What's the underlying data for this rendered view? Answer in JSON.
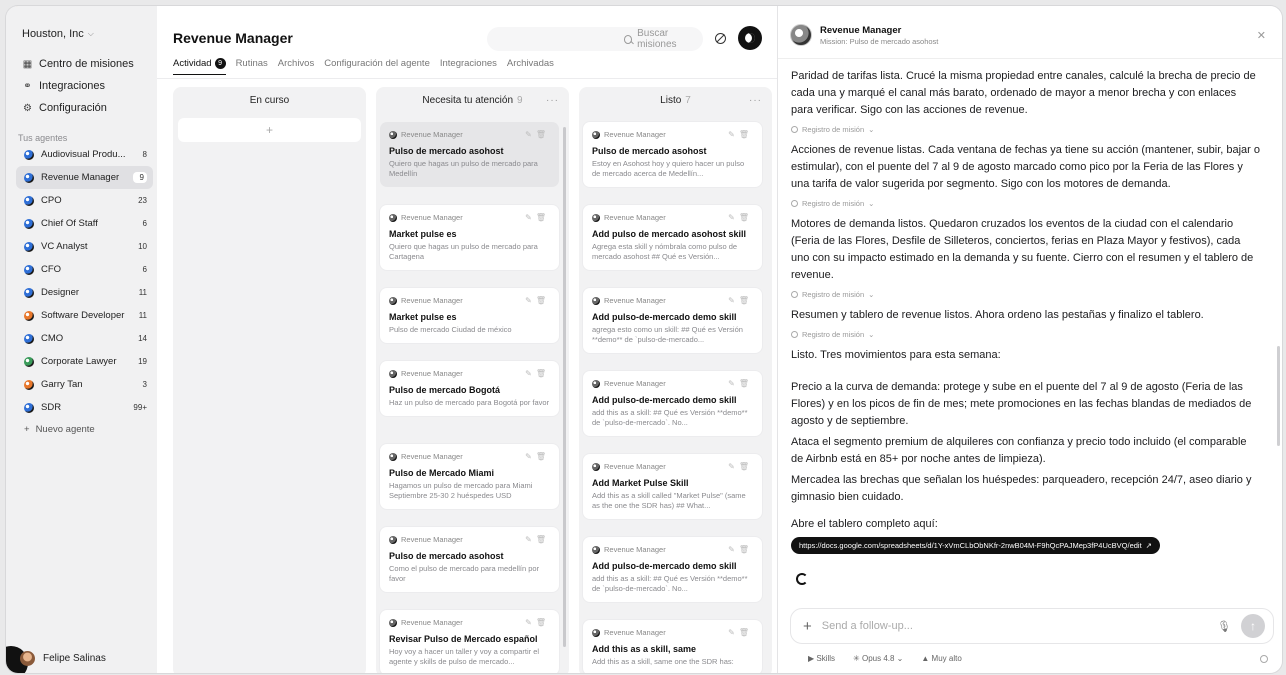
{
  "sidebar": {
    "workspace": "Houston, Inc",
    "nav": [
      {
        "label": "Centro de misiones",
        "icon": "grid-icon"
      },
      {
        "label": "Integraciones",
        "icon": "link-icon"
      },
      {
        "label": "Configuración",
        "icon": "gear-icon"
      }
    ],
    "agents_label": "Tus agentes",
    "agents": [
      {
        "name": "Audiovisual Produ...",
        "count": "8"
      },
      {
        "name": "Revenue Manager",
        "count": "9"
      },
      {
        "name": "CPO",
        "count": "23"
      },
      {
        "name": "Chief Of Staff",
        "count": "6"
      },
      {
        "name": "VC Analyst",
        "count": "10"
      },
      {
        "name": "CFO",
        "count": "6"
      },
      {
        "name": "Designer",
        "count": "11"
      },
      {
        "name": "Software Developer",
        "count": "11"
      },
      {
        "name": "CMO",
        "count": "14"
      },
      {
        "name": "Corporate Lawyer",
        "count": "19"
      },
      {
        "name": "Garry Tan",
        "count": "3"
      },
      {
        "name": "SDR",
        "count": "99+"
      }
    ],
    "new_agent": "Nuevo agente",
    "user": "Felipe Salinas"
  },
  "main": {
    "title": "Revenue Manager",
    "search_placeholder": "Buscar misiones",
    "tabs": [
      {
        "label": "Actividad",
        "badge": "9"
      },
      {
        "label": "Rutinas"
      },
      {
        "label": "Archivos"
      },
      {
        "label": "Configuración del agente"
      },
      {
        "label": "Integraciones"
      },
      {
        "label": "Archivadas"
      }
    ],
    "columns": [
      {
        "title": "En curso",
        "count": "",
        "cards": []
      },
      {
        "title": "Necesita tu atención",
        "count": "9",
        "cards": [
          {
            "agent": "Revenue Manager",
            "title": "Pulso de mercado asohost",
            "desc": "Quiero que hagas un pulso de mercado para Medellín"
          },
          {
            "agent": "Revenue Manager",
            "title": "Market pulse es",
            "desc": "Quiero que hagas un pulso de mercado para Cartagena"
          },
          {
            "agent": "Revenue Manager",
            "title": "Market pulse es",
            "desc": "Pulso de mercado Ciudad de méxico"
          },
          {
            "agent": "Revenue Manager",
            "title": "Pulso de mercado Bogotá",
            "desc": "Haz un pulso de mercado para Bogotá por favor"
          },
          {
            "agent": "Revenue Manager",
            "title": "Pulso de Mercado Miami",
            "desc": "Hagamos un pulso de mercado para Miami Septiembre 25-30 2 huéspedes USD"
          },
          {
            "agent": "Revenue Manager",
            "title": "Pulso de mercado asohost",
            "desc": "Como el pulso de mercado para medellín por favor"
          },
          {
            "agent": "Revenue Manager",
            "title": "Revisar Pulso de Mercado español",
            "desc": "Hoy voy a hacer un taller y voy a compartir el agente y skills de pulso de mercado..."
          }
        ]
      },
      {
        "title": "Listo",
        "count": "7",
        "cards": [
          {
            "agent": "Revenue Manager",
            "title": "Pulso de mercado asohost",
            "desc": "Estoy en Asohost hoy y quiero hacer un pulso de mercado acerca de Medellín..."
          },
          {
            "agent": "Revenue Manager",
            "title": "Add pulso de mercado asohost skill",
            "desc": "Agrega esta skill y nómbrala como pulso de mercado asohost ## Qué es Versión..."
          },
          {
            "agent": "Revenue Manager",
            "title": "Add pulso-de-mercado demo skill",
            "desc": "agrega esto como un skill: ## Qué es Versión **demo** de `pulso-de-mercado..."
          },
          {
            "agent": "Revenue Manager",
            "title": "Add pulso-de-mercado demo skill",
            "desc": "add this as a skill: ## Qué es Versión **demo** de `pulso-de-mercado`. No..."
          },
          {
            "agent": "Revenue Manager",
            "title": "Add Market Pulse Skill",
            "desc": "Add this as a skill called \"Market Pulse\" (same as the one the SDR has) ## What..."
          },
          {
            "agent": "Revenue Manager",
            "title": "Add pulso-de-mercado demo skill",
            "desc": "add this as a skill: ## Qué es Versión **demo** de `pulso-de-mercado`. No..."
          },
          {
            "agent": "Revenue Manager",
            "title": "Add this as a skill, same",
            "desc": "Add this as a skill, same one the SDR has:"
          }
        ]
      }
    ]
  },
  "chat": {
    "title": "Revenue Manager",
    "subtitle": "Mission: Pulso de mercado asohost",
    "log_label": "Registro de misión",
    "p1": "Paridad de tarifas lista. Crucé la misma propiedad entre canales, calculé la brecha de precio de cada una y marqué el canal más barato, ordenado de mayor a menor brecha y con enlaces para verificar. Sigo con las acciones de revenue.",
    "p2": "Acciones de revenue listas. Cada ventana de fechas ya tiene su acción (mantener, subir, bajar o estimular), con el puente del 7 al 9 de agosto marcado como pico por la Feria de las Flores y una tarifa de valor sugerida por segmento. Sigo con los motores de demanda.",
    "p3": "Motores de demanda listos. Quedaron cruzados los eventos de la ciudad con el calendario (Feria de las Flores, Desfile de Silleteros, conciertos, ferias en Plaza Mayor y festivos), cada uno con su impacto estimado en la demanda y su fuente. Cierro con el resumen y el tablero de revenue.",
    "p4": "Resumen y tablero de revenue listos. Ahora ordeno las pestañas y finalizo el tablero.",
    "p5": "Listo. Tres movimientos para esta semana:",
    "p6": "Precio a la curva de demanda: protege y sube en el puente del 7 al 9 de agosto (Feria de las Flores) y en los picos de fin de mes; mete promociones en las fechas blandas de mediados de agosto y de septiembre.",
    "p7": "Ataca el segmento premium de alquileres con confianza y precio todo incluido (el comparable de Airbnb está en 85+ por noche antes de limpieza).",
    "p8": "Mercadea las brechas que señalan los huéspedes: parqueadero, recepción 24/7, aseo diario y gimnasio bien cuidado.",
    "p9": "Abre el tablero completo aquí:",
    "link": "https://docs.google.com/spreadsheets/d/1Y-xVmCLbObNKfr-2nwB04M-F9hQcPAJMep3fP4UcBVQ/edit",
    "input_placeholder": "Send a follow-up...",
    "skills": "Skills",
    "model": "Opus 4.8",
    "effort": "Muy alto"
  }
}
